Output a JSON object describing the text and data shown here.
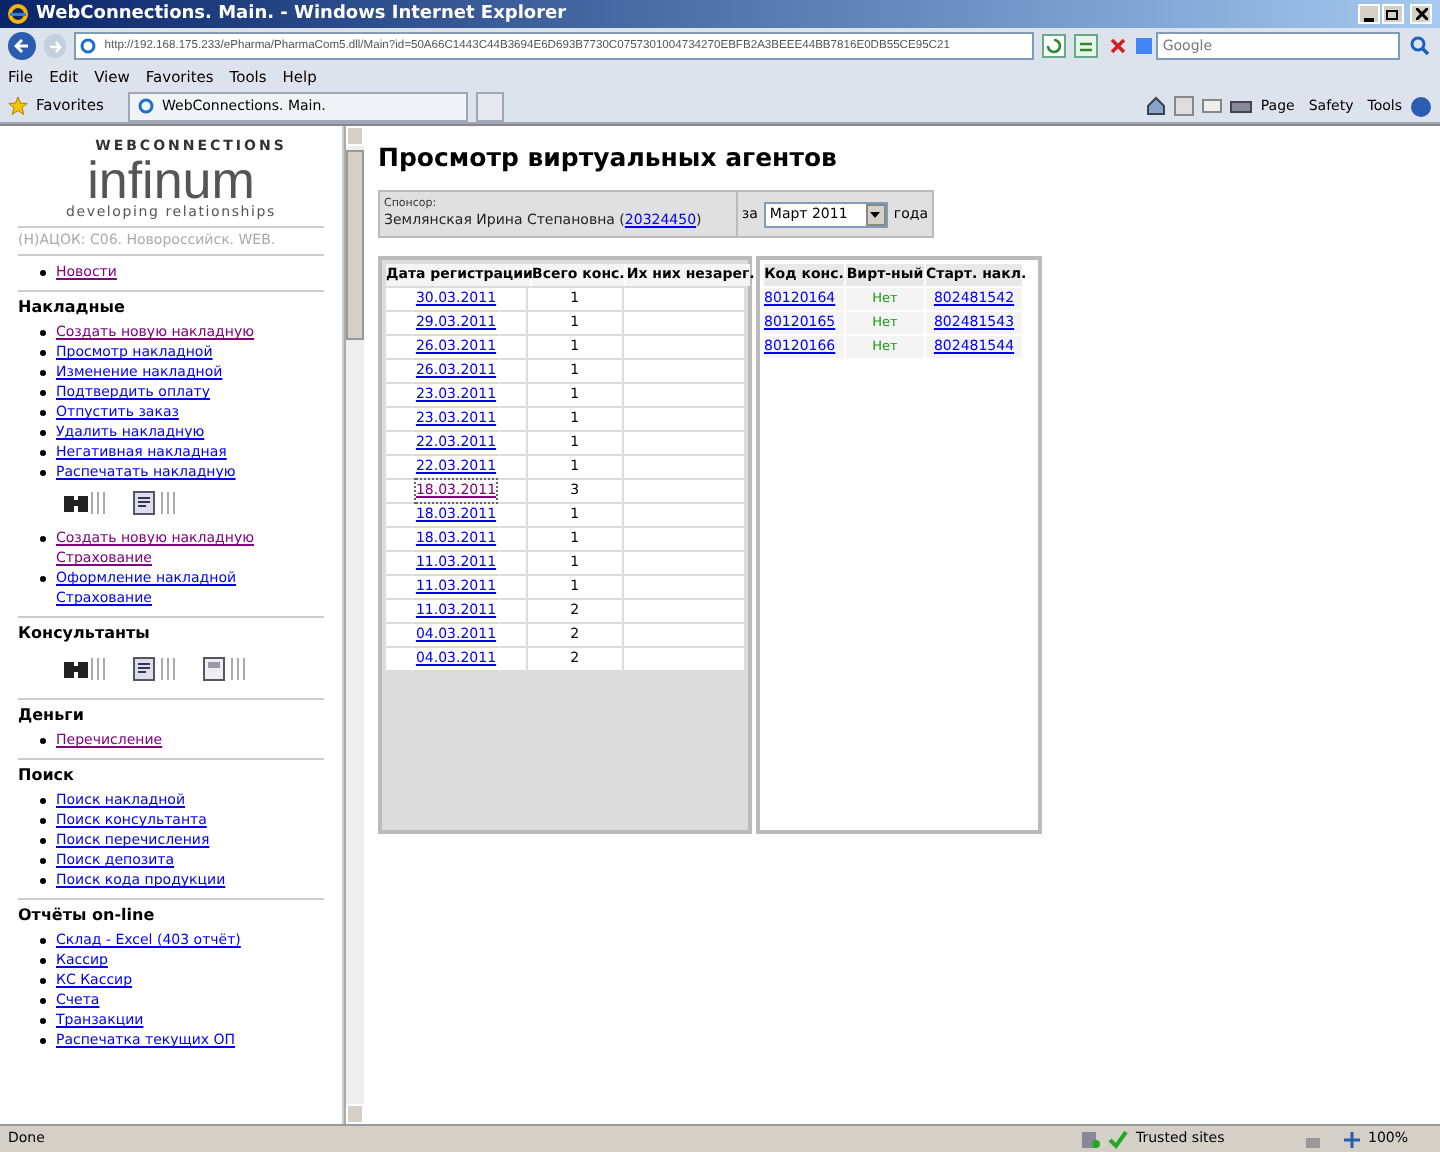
{
  "window": {
    "title": "WebConnections. Main. - Windows Internet Explorer"
  },
  "address_bar": {
    "url": "http://192.168.175.233/ePharma/PharmaCom5.dll/Main?id=50A66C1443C44B3694E6D693B7730C0757301004734270EBFB2A3BEEE44BB7816E0DB55CE95C21"
  },
  "search": {
    "placeholder": "Google"
  },
  "menu": [
    "File",
    "Edit",
    "View",
    "Favorites",
    "Tools",
    "Help"
  ],
  "favorites_bar": {
    "label": "Favorites",
    "tab": "WebConnections. Main.",
    "commands": [
      "Page",
      "Safety",
      "Tools"
    ]
  },
  "sidebar": {
    "logo": {
      "brand": "WEBCONNECTIONS",
      "name": "infinum",
      "tagline": "developing relationships"
    },
    "org": "(Н)АЦОК: С06. Новороссийск. WEB.",
    "sections": [
      {
        "blocks": [
          {
            "kind": "links",
            "items": [
              {
                "label": "Новости",
                "visited": true
              }
            ]
          }
        ]
      },
      {
        "heading": "Накладные",
        "blocks": [
          {
            "kind": "links",
            "items": [
              {
                "label": "Создать новую накладную",
                "visited": true
              },
              {
                "label": "Просмотр накладной",
                "visited": false
              },
              {
                "label": "Изменение накладной",
                "visited": false
              },
              {
                "label": "Подтвердить оплату",
                "visited": false
              },
              {
                "label": "Отпустить заказ",
                "visited": false
              },
              {
                "label": "Удалить накладную",
                "visited": false
              },
              {
                "label": "Негативная накладная",
                "visited": false
              },
              {
                "label": "Распечатать накладную",
                "visited": false
              }
            ]
          },
          {
            "kind": "icons",
            "icons": [
              {
                "kind": "binoculars"
              },
              {
                "kind": "document"
              }
            ]
          },
          {
            "kind": "links",
            "items": [
              {
                "label": "Создать новую накладную Страхование",
                "visited": true
              },
              {
                "label": "Оформление накладной Страхование",
                "visited": false
              }
            ]
          }
        ]
      },
      {
        "heading": "Консультанты",
        "blocks": [
          {
            "kind": "icons",
            "icons": [
              {
                "kind": "binoculars"
              },
              {
                "kind": "document"
              },
              {
                "kind": "calculator"
              }
            ]
          }
        ]
      },
      {
        "heading": "Деньги",
        "blocks": [
          {
            "kind": "links",
            "items": [
              {
                "label": "Перечисление",
                "visited": true
              }
            ]
          }
        ]
      },
      {
        "heading": "Поиск",
        "blocks": [
          {
            "kind": "links",
            "items": [
              {
                "label": "Поиск накладной",
                "visited": false
              },
              {
                "label": "Поиск консультанта",
                "visited": false
              },
              {
                "label": "Поиск перечисления",
                "visited": false
              },
              {
                "label": "Поиск депозита",
                "visited": false
              },
              {
                "label": "Поиск кода продукции",
                "visited": false
              }
            ]
          }
        ]
      },
      {
        "heading": "Отчёты on-line",
        "blocks": [
          {
            "kind": "links",
            "items": [
              {
                "label": "Склад - Excel (403 отчёт)",
                "visited": false
              },
              {
                "label": "Кассир",
                "visited": false
              },
              {
                "label": "КС Кассир",
                "visited": false
              },
              {
                "label": "Счета",
                "visited": false
              },
              {
                "label": "Транзакции",
                "visited": false
              },
              {
                "label": "Распечатка текущих ОП",
                "visited": false
              }
            ]
          }
        ]
      }
    ]
  },
  "page": {
    "title": "Просмотр виртуальных агентов",
    "sponsor": {
      "label": "Спонсор:",
      "name": "Землянская Ирина Степановна (",
      "id": "20324450",
      "close": ")"
    },
    "period": {
      "prefix": "за",
      "month": "Март 2011",
      "suffix": "года"
    },
    "dates_table": {
      "columns": [
        "Дата регистрации",
        "Всего конс.",
        "Их них незарег."
      ],
      "rows": [
        {
          "date": "30.03.2011",
          "total": "1",
          "visited": false
        },
        {
          "date": "29.03.2011",
          "total": "1",
          "visited": false
        },
        {
          "date": "26.03.2011",
          "total": "1",
          "visited": false
        },
        {
          "date": "26.03.2011",
          "total": "1",
          "visited": false
        },
        {
          "date": "23.03.2011",
          "total": "1",
          "visited": false
        },
        {
          "date": "23.03.2011",
          "total": "1",
          "visited": false
        },
        {
          "date": "22.03.2011",
          "total": "1",
          "visited": false
        },
        {
          "date": "22.03.2011",
          "total": "1",
          "visited": false
        },
        {
          "date": "18.03.2011",
          "total": "3",
          "visited": true
        },
        {
          "date": "18.03.2011",
          "total": "1",
          "visited": false
        },
        {
          "date": "18.03.2011",
          "total": "1",
          "visited": false
        },
        {
          "date": "11.03.2011",
          "total": "1",
          "visited": false
        },
        {
          "date": "11.03.2011",
          "total": "1",
          "visited": false
        },
        {
          "date": "11.03.2011",
          "total": "2",
          "visited": false
        },
        {
          "date": "04.03.2011",
          "total": "2",
          "visited": false
        },
        {
          "date": "04.03.2011",
          "total": "2",
          "visited": false
        }
      ]
    },
    "agents_table": {
      "columns": [
        "Код конс.",
        "Вирт-ный",
        "Старт. накл."
      ],
      "rows": [
        {
          "code": "80120164",
          "virtual": "Нет",
          "invoice": "802481542"
        },
        {
          "code": "80120165",
          "virtual": "Нет",
          "invoice": "802481543"
        },
        {
          "code": "80120166",
          "virtual": "Нет",
          "invoice": "802481544"
        }
      ]
    }
  },
  "status_bar": {
    "text": "Done",
    "zone": "Trusted sites",
    "zoom": "100%"
  }
}
